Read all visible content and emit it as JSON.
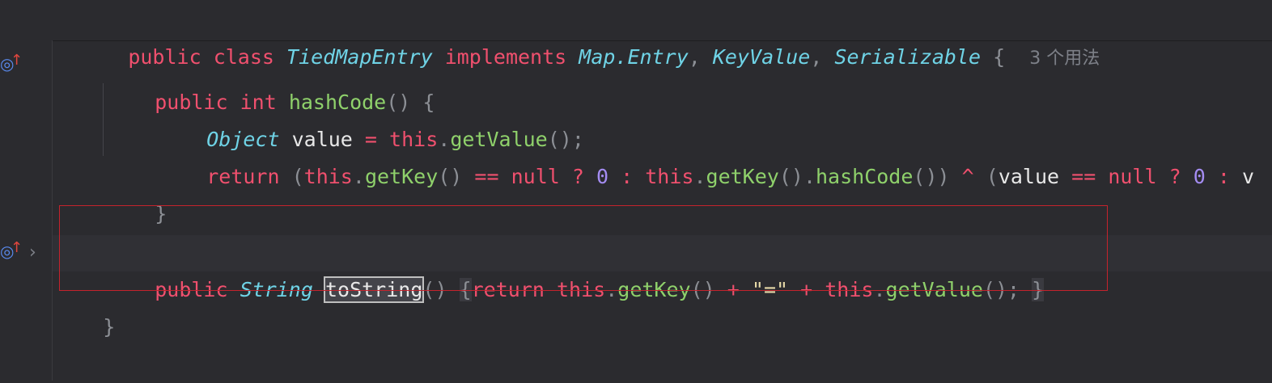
{
  "header": {
    "kw_public": "public",
    "kw_class": "class",
    "class_name": "TiedMapEntry",
    "kw_implements": "implements",
    "iface1": "Map.Entry",
    "comma1": ",",
    "iface2": "KeyValue",
    "comma2": ",",
    "iface3": "Serializable",
    "brace": "{",
    "usage_hint": "3 个用法"
  },
  "lines": {
    "l1": {
      "kw1": "public",
      "kw2": "int",
      "fn": "hashCode",
      "rest": "() {"
    },
    "l2": {
      "type": "Object",
      "var": "value",
      "op": "=",
      "kw": "this",
      "dot": ".",
      "fn": "getValue",
      "rest": "();"
    },
    "l3": {
      "kw_return": "return",
      "p1": "(",
      "this1": "this",
      "dot1": ".",
      "fn1": "getKey",
      "p2": "()",
      "op1": "==",
      "null1": "null",
      "q1": "?",
      "zero1": "0",
      "c1": ":",
      "this2": "this",
      "dot2": ".",
      "fn2": "getKey",
      "p3": "().",
      "fn3": "hashCode",
      "p4": "())",
      "xor": "^",
      "p5": "(",
      "var": "value",
      "op2": "==",
      "null2": "null",
      "q2": "?",
      "zero2": "0",
      "c2": ":",
      "tail": "v"
    },
    "l4": {
      "brace": "}"
    },
    "l5": {
      "kw1": "public",
      "type": "String",
      "fn": "toString",
      "paren": "()",
      "open": "{",
      "kw_return": "return",
      "this1": "this",
      "dot1": ".",
      "fn1": "getKey",
      "p1": "()",
      "plus1": "+",
      "str": "\"=\"",
      "plus2": "+",
      "this2": "this",
      "dot2": ".",
      "fn2": "getValue",
      "p2": "();",
      "close": "}"
    },
    "l6": {
      "brace": "}"
    }
  },
  "gutter": {
    "icon1": "override-up-icon",
    "icon2": "override-up-icon",
    "fold": "fold-chevron-icon"
  },
  "colors": {
    "keyword": "#f0506e",
    "type": "#6fd3e6",
    "function": "#8fd16b",
    "number": "#a48cf2",
    "highlight_border": "#c5232c"
  }
}
